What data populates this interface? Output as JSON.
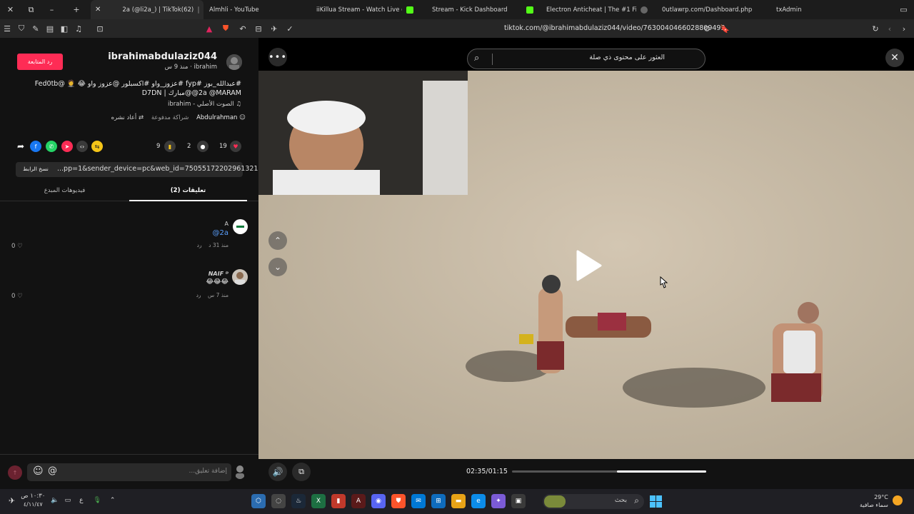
{
  "browser": {
    "tabs": [
      {
        "title": "2a (@li2a_) | TikTok(62)",
        "active": true,
        "color": "#111111"
      },
      {
        "title": "Almhli - YouTube",
        "active": false,
        "color": "#ff0000"
      },
      {
        "title": "iiKillua Stream - Watch Live on K",
        "active": false,
        "color": "#53fc18"
      },
      {
        "title": "Stream - Kick Dashboard",
        "active": false,
        "color": "#53fc18"
      },
      {
        "title": "Electron Anticheat | The #1 FiveM A",
        "active": false,
        "color": "#777777"
      },
      {
        "title": "0utlawrp.com/Dashboard.php",
        "active": false,
        "color": "#777777"
      },
      {
        "title": "txAdmin",
        "active": false,
        "color": "#777777"
      }
    ],
    "url": "tiktok.com/@ibrahimabdulaziz044/video/7630040466028809493"
  },
  "post": {
    "follow_label": "رد المتابعة",
    "username": "ibrahimabdulaziz044",
    "subline": "ibrahim · منذ 9 س",
    "description": "#عبدالله_بوز #fyp #عزوز_واو #اكسبلور @عزوز واو 😂 🤵 @Fed0tb @2a @MARAM@مبارك | D7DN",
    "sound": "♫ الصوت الأصلي - ibrahim",
    "repost_by": "Abdulrahman",
    "repost_text": "أعاد نشره",
    "paid_partnership": "شراكة مدفوعة",
    "likes": "19",
    "comments": "2",
    "saves": "9",
    "link": "...pp=1&sender_device=pc&web_id=7505517220296132151",
    "copy_link_label": "نسخ الرابط"
  },
  "tabs": {
    "comments_label": "(2) تعليقات",
    "creator_videos_label": "فيديوهات المبدع"
  },
  "comments_list": [
    {
      "name": "A",
      "text": "@2a",
      "meta": "منذ 31 د    رد",
      "likes": "0"
    },
    {
      "name": "NAIF ᴰ",
      "text": "😂😂😂",
      "meta": "منذ 7 س    رد",
      "likes": "0"
    }
  ],
  "composer": {
    "placeholder": "إضافة تعليق..."
  },
  "video": {
    "search_placeholder": "العثور على محتوى ذي صلة",
    "time": "02:35/01:15",
    "progress_played": 0.46
  },
  "taskbar": {
    "time": "١٠:٣٠ ص",
    "date": "٤/١١/٤٧",
    "lang": "ع",
    "search_label": "بحث",
    "weather_temp": "29°C",
    "weather_text": "سماء صافية"
  }
}
